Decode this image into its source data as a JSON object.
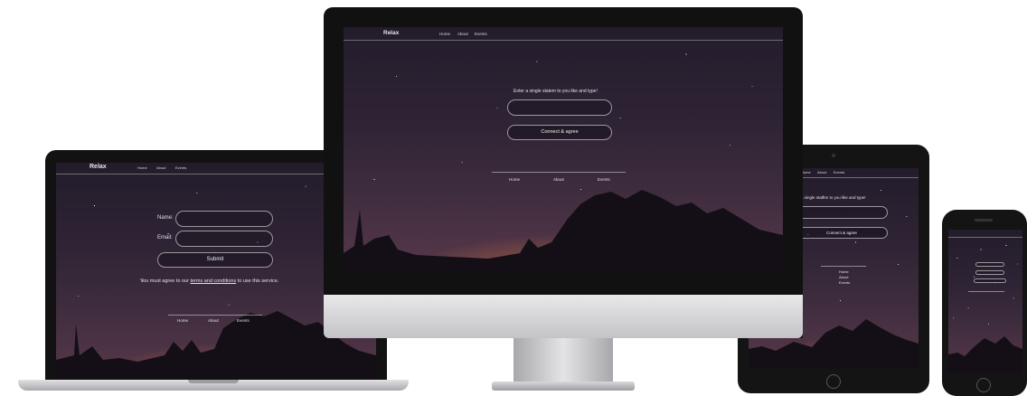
{
  "brand": "Relax",
  "nav": {
    "home": "Home",
    "about": "About",
    "events": "Events"
  },
  "laptop": {
    "name_label": "Name:",
    "email_label": "Email:",
    "submit_label": "Submit",
    "agree_prefix": "You must agree to our ",
    "agree_link": "terms and conditions",
    "agree_suffix": " to use this service."
  },
  "desktop": {
    "prompt": "Enter a single statem to you like and type!",
    "connect_label": "Connect & agree"
  },
  "tablet": {
    "prompt": "a single statem to you like and type!",
    "connect_label": "Connect & agree"
  },
  "colors": {
    "sky_top": "#231c2b",
    "sky_glow": "#d07a3e",
    "bezel": "#111111",
    "aluminium": "#cfcfd2"
  }
}
